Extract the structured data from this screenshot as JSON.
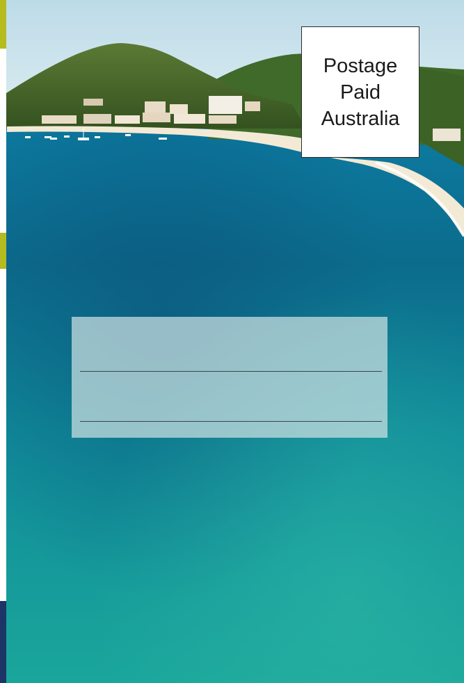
{
  "postage_indicia": {
    "lines": [
      "Postage",
      "Paid",
      "Australia"
    ]
  },
  "address_panel": {
    "lines": 2
  },
  "colors": {
    "sea_deep": "#0c6f85",
    "sea_light": "#19a9a3",
    "sky": "#cfe6ef",
    "hill": "#4a6d2c",
    "sand": "#f1e6cf",
    "edge_accent": "#b6bb1f",
    "edge_navy": "#1c3566"
  }
}
